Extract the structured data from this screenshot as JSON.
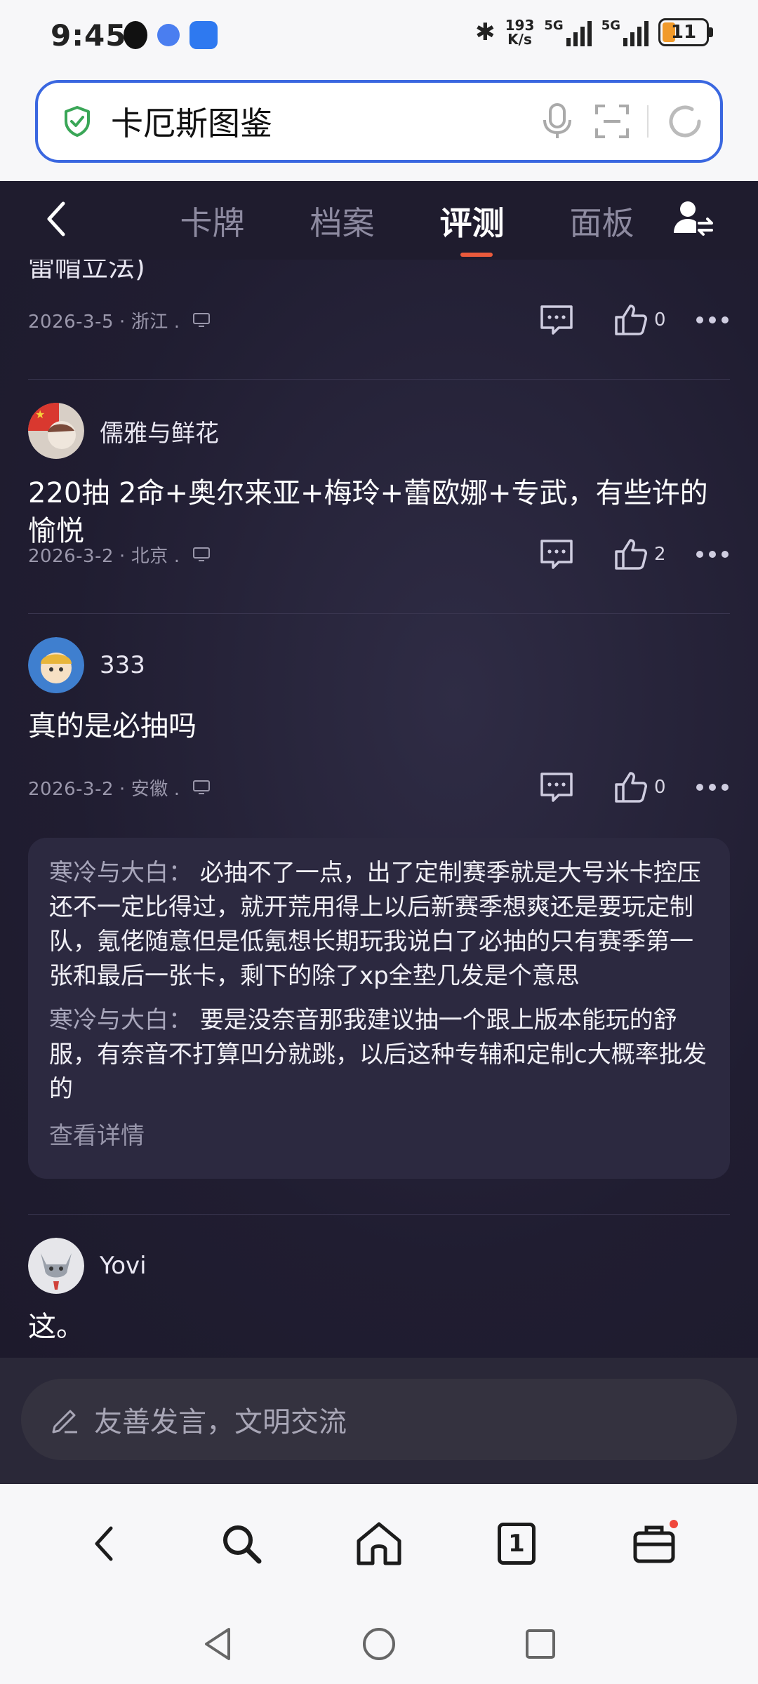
{
  "status_bar": {
    "time": "9:45",
    "net_speed_value": "193",
    "net_speed_unit": "K/s",
    "signal_1_label": "5G",
    "signal_2_label": "5G",
    "battery_level": "11"
  },
  "url_bar": {
    "query": "卡厄斯图鉴"
  },
  "top_nav": {
    "tabs": [
      {
        "label": "卡牌",
        "active": false
      },
      {
        "label": "档案",
        "active": false
      },
      {
        "label": "评测",
        "active": true
      },
      {
        "label": "面板",
        "active": false
      }
    ]
  },
  "comments": [
    {
      "partial_text": "雷帽立法)",
      "date": "2026-3-5",
      "location": "浙江",
      "likes": "0"
    },
    {
      "author": "儒雅与鲜花",
      "text": "220抽 2命+奥尔来亚+梅玲+蕾欧娜+专武，有些许的愉悦",
      "date": "2026-3-2",
      "location": "北京",
      "likes": "2"
    },
    {
      "author": "333",
      "text": "真的是必抽吗",
      "date": "2026-3-2",
      "location": "安徽",
      "likes": "0",
      "replies": [
        {
          "name": "寒冷与大白：",
          "text": "必抽不了一点，出了定制赛季就是大号米卡控压还不一定比得过，就开荒用得上以后新赛季想爽还是要玩定制队，氪佬随意但是低氪想长期玩我说白了必抽的只有赛季第一张和最后一张卡，剩下的除了xp全垫几发是个意思"
        },
        {
          "name": "寒冷与大白：",
          "text": "要是没奈音那我建议抽一个跟上版本能玩的舒服，有奈音不打算凹分就跳，以后这种专辅和定制c大概率批发的"
        }
      ],
      "see_more": "查看详情"
    },
    {
      "author": "Yovi",
      "text": "这。"
    }
  ],
  "input_bar": {
    "placeholder": "友善发言，文明交流"
  },
  "browser_bar": {
    "tab_count": "1"
  },
  "colors": {
    "accent": "#ea5a3c",
    "url_border": "#3a67e0",
    "background": "#1f1c2e"
  }
}
